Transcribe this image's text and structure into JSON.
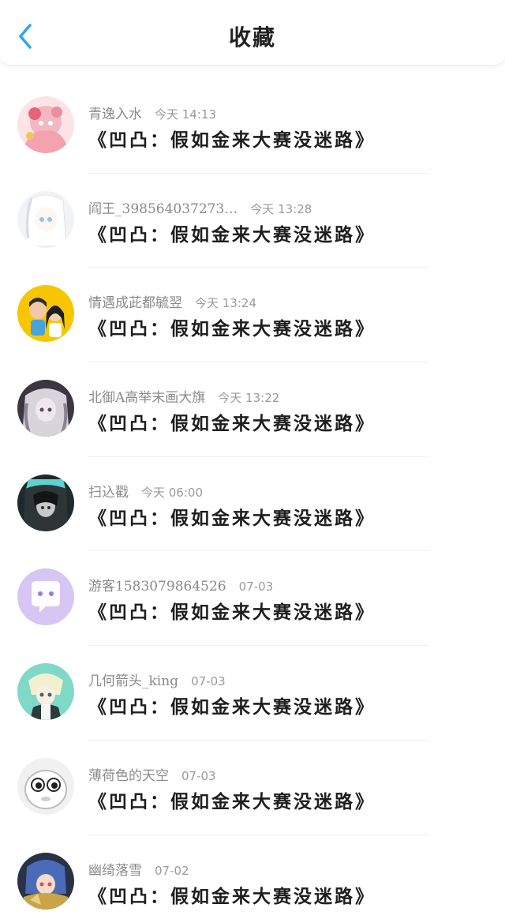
{
  "header": {
    "title": "收藏",
    "back_icon": "chevron-left-icon",
    "accent_color": "#2aa7ee"
  },
  "favorites": [
    {
      "name": "青逸入水",
      "time": "今天 14:13",
      "title": "《凹凸：假如金来大赛没迷路》",
      "avatar": "avatar-anime-pink"
    },
    {
      "name": "阎王_398564037273…",
      "time": "今天 13:28",
      "title": "《凹凸：假如金来大赛没迷路》",
      "avatar": "avatar-anime-white"
    },
    {
      "name": "情遇成茈都毓翌",
      "time": "今天 13:24",
      "title": "《凹凸：假如金来大赛没迷路》",
      "avatar": "avatar-couple-yellow"
    },
    {
      "name": "北御A高举末画大旗",
      "time": "今天 13:22",
      "title": "《凹凸：假如金来大赛没迷路》",
      "avatar": "avatar-anime-dark"
    },
    {
      "name": "扫込戳",
      "time": "今天 06:00",
      "title": "《凹凸：假如金来大赛没迷路》",
      "avatar": "avatar-anime-teal"
    },
    {
      "name": "游客1583079864526",
      "time": "07-03",
      "title": "《凹凸：假如金来大赛没迷路》",
      "avatar": "avatar-chat-bubble"
    },
    {
      "name": "几何箭头_king",
      "time": "07-03",
      "title": "《凹凸：假如金来大赛没迷路》",
      "avatar": "avatar-anime-blond"
    },
    {
      "name": "薄荷色的天空",
      "time": "07-03",
      "title": "《凹凸：假如金来大赛没迷路》",
      "avatar": "avatar-cartoon-face"
    },
    {
      "name": "幽绮落雪",
      "time": "07-02",
      "title": "《凹凸：假如金来大赛没迷路》",
      "avatar": "avatar-anime-blue"
    }
  ]
}
